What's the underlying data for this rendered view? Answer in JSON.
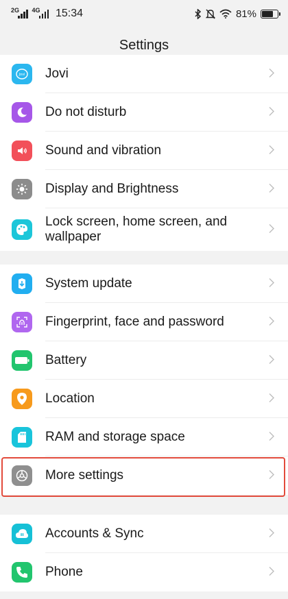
{
  "status_bar": {
    "network1": "2G",
    "network2": "4G",
    "time": "15:34",
    "battery_percent": "81%",
    "battery_level": 0.81,
    "icons": [
      "bluetooth-icon",
      "mute-icon",
      "wifi-icon",
      "battery-icon"
    ]
  },
  "header": {
    "title": "Settings"
  },
  "groups": [
    [
      {
        "id": "jovi",
        "label": "Jovi",
        "icon": "jovi-icon",
        "color": "#2bb7ef",
        "icon_text": "Jovi"
      },
      {
        "id": "do-not-disturb",
        "label": "Do not disturb",
        "icon": "moon-icon",
        "color": "#a657e8"
      },
      {
        "id": "sound-and-vibration",
        "label": "Sound and vibration",
        "icon": "speaker-icon",
        "color": "#f2505a"
      },
      {
        "id": "display-and-brightness",
        "label": "Display and Brightness",
        "icon": "sun-icon",
        "color": "#8c8c8c"
      },
      {
        "id": "lock-screen",
        "label": "Lock screen, home screen, and wallpaper",
        "icon": "palette-icon",
        "color": "#1cc6d9"
      }
    ],
    [
      {
        "id": "system-update",
        "label": "System update",
        "icon": "system-update-icon",
        "color": "#21aef0"
      },
      {
        "id": "fingerprint",
        "label": "Fingerprint, face and password",
        "icon": "fingerprint-icon",
        "color": "#b067ef"
      },
      {
        "id": "battery",
        "label": "Battery",
        "icon": "battery-icon",
        "color": "#22c56e"
      },
      {
        "id": "location",
        "label": "Location",
        "icon": "location-pin-icon",
        "color": "#f79a1c"
      },
      {
        "id": "ram-and-storage",
        "label": "RAM and storage space",
        "icon": "sd-card-icon",
        "color": "#19c4db"
      },
      {
        "id": "more-settings",
        "label": "More settings",
        "icon": "gear-icon",
        "color": "#8f8f8f"
      }
    ],
    [
      {
        "id": "accounts-sync",
        "label": "Accounts & Sync",
        "icon": "accounts-sync-icon",
        "color": "#16c0d6"
      },
      {
        "id": "phone",
        "label": "Phone",
        "icon": "phone-icon",
        "color": "#22c56e"
      }
    ]
  ]
}
